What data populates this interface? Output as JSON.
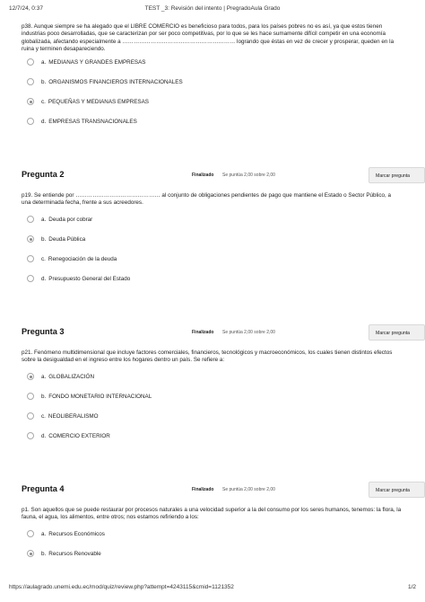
{
  "header": {
    "datetime": "12/7/24, 0:37",
    "title": "TEST _3: Revisión del intento | PregradoAula Grado"
  },
  "q1": {
    "text": "p38. Aunque siempre se ha alegado que el LIBRE COMERCIO es beneficioso para todos, para los países pobres no es así, ya que estos tienen industrias poco desarrolladas, que se caracterizan por ser poco competitivas, por lo que se les hace sumamente difícil competir en una economía globalizada, afectando especialmente a …………………………………………………… logrando que éstas en vez de crecer y prosperar, queden en la ruina y terminen desapareciendo.",
    "options": [
      {
        "letter": "a.",
        "text": "MEDIANAS Y GRANDES EMPRESAS",
        "selected": false
      },
      {
        "letter": "b.",
        "text": "ORGANISMOS FINANCIEROS INTERNACIONALES",
        "selected": false
      },
      {
        "letter": "c.",
        "text": "PEQUEÑAS Y MEDIANAS EMPRESAS",
        "selected": true
      },
      {
        "letter": "d.",
        "text": "EMPRESAS TRANSNACIONALES",
        "selected": false
      }
    ]
  },
  "q2": {
    "number": "Pregunta 2",
    "state": "Finalizado",
    "grade": "Se puntúa 2,00 sobre 2,00",
    "flag": "Marcar pregunta",
    "text": "p19. Se entiende por ……………………………………… al conjunto de obligaciones pendientes de pago que mantiene el Estado o Sector Público, a una determinada fecha, frente a sus acreedores.",
    "options": [
      {
        "letter": "a.",
        "text": "Deuda por cobrar",
        "selected": false
      },
      {
        "letter": "b.",
        "text": "Deuda Pública",
        "selected": true
      },
      {
        "letter": "c.",
        "text": "Renegociación de la deuda",
        "selected": false
      },
      {
        "letter": "d.",
        "text": "Presupuesto General del Estado",
        "selected": false
      }
    ]
  },
  "q3": {
    "number": "Pregunta 3",
    "state": "Finalizado",
    "grade": "Se puntúa 2,00 sobre 2,00",
    "flag": "Marcar pregunta",
    "text": "p21. Fenómeno multidimensional que incluye factores comerciales, financieros, tecnológicos y macroeconómicos, los cuales tienen distintos efectos sobre la desigualdad en el ingreso entre los hogares dentro un país. Se refiere a:",
    "options": [
      {
        "letter": "a.",
        "text": "GLOBALIZACIÓN",
        "selected": true
      },
      {
        "letter": "b.",
        "text": "FONDO MONETARIO INTERNACIONAL",
        "selected": false
      },
      {
        "letter": "c.",
        "text": "NEOLIBERALISMO",
        "selected": false
      },
      {
        "letter": "d.",
        "text": "COMERCIO EXTERIOR",
        "selected": false
      }
    ]
  },
  "q4": {
    "number": "Pregunta 4",
    "state": "Finalizado",
    "grade": "Se puntúa 2,00 sobre 2,00",
    "flag": "Marcar pregunta",
    "text": "p1. Son aquellos que se puede restaurar por procesos naturales a una velocidad superior a la del consumo por los seres humanos, tenemos: la flora, la fauna, el agua, los alimentos, entre otros; nos estamos refiriendo a los:",
    "options": [
      {
        "letter": "a.",
        "text": "Recursos Económicos",
        "selected": false
      },
      {
        "letter": "b.",
        "text": "Recursos Renovable",
        "selected": true
      }
    ]
  },
  "footer": {
    "url": "https://aulagrado.unemi.edu.ec/mod/quiz/review.php?attempt=4243115&cmid=1121352",
    "page": "1/2"
  }
}
